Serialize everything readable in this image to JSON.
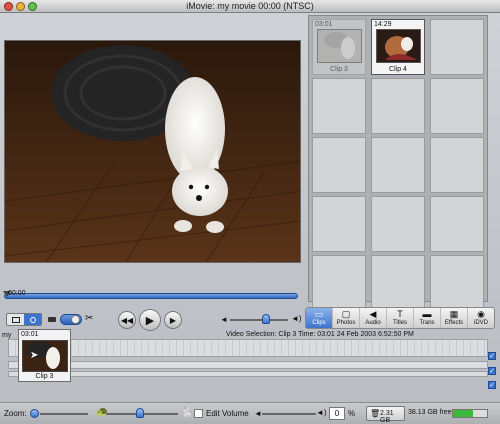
{
  "window": {
    "title": "iMovie: my movie   00:00 (NTSC)"
  },
  "scrubber": {
    "timecode": "00:00"
  },
  "clips": [
    {
      "time": "03:01",
      "name": "Clip 3",
      "dimmed": true
    },
    {
      "time": "14:29",
      "name": "Clip 4",
      "dimmed": false
    }
  ],
  "panels": [
    {
      "label": "Clips",
      "icon": "clips-icon",
      "glyph": "▭",
      "active": true
    },
    {
      "label": "Photos",
      "icon": "photos-icon",
      "glyph": "▢",
      "active": false
    },
    {
      "label": "Audio",
      "icon": "audio-icon",
      "glyph": "◀",
      "active": false
    },
    {
      "label": "Titles",
      "icon": "titles-icon",
      "glyph": "T",
      "active": false
    },
    {
      "label": "Trans",
      "icon": "transitions-icon",
      "glyph": "▬",
      "active": false
    },
    {
      "label": "Effects",
      "icon": "effects-icon",
      "glyph": "▦",
      "active": false
    },
    {
      "label": "iDVD",
      "icon": "idvd-icon",
      "glyph": "◉",
      "active": false
    }
  ],
  "status": {
    "video_selection": "Video Selection: Clip 3  Time: 03:01 24 Feb 2003 6:52:50 PM"
  },
  "timeline": {
    "clip": {
      "time": "03:01",
      "name": "Clip 3"
    },
    "label_stub": "my"
  },
  "bottom": {
    "zoom_label": "Zoom:",
    "edit_volume_label": "Edit Volume",
    "volume_value": "0",
    "volume_unit": "%",
    "trash_size": "2.31 GB",
    "free_space": "38.13 GB free"
  },
  "colors": {
    "accent": "#3c74cc",
    "free_bar": "#3bbb3b"
  }
}
